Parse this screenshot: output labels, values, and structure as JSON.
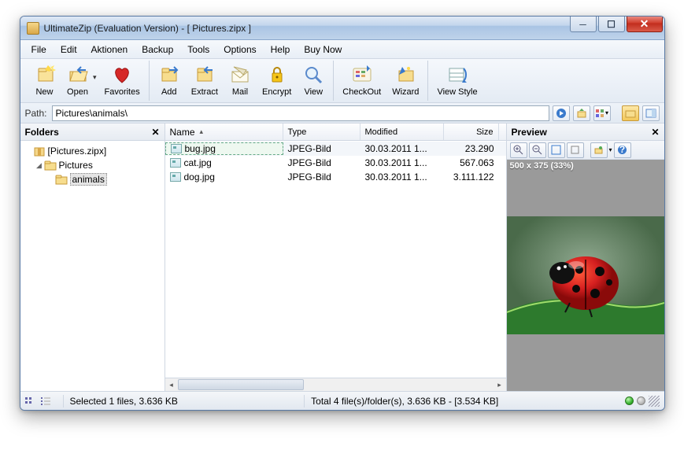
{
  "window": {
    "title": "UltimateZip (Evaluation Version) - [ Pictures.zipx ]"
  },
  "menu": {
    "file": "File",
    "edit": "Edit",
    "aktionen": "Aktionen",
    "backup": "Backup",
    "tools": "Tools",
    "options": "Options",
    "help": "Help",
    "buy_now": "Buy Now"
  },
  "toolbar": {
    "new": "New",
    "open": "Open",
    "favorites": "Favorites",
    "add": "Add",
    "extract": "Extract",
    "mail": "Mail",
    "encrypt": "Encrypt",
    "view": "View",
    "checkout": "CheckOut",
    "wizard": "Wizard",
    "view_style": "View Style"
  },
  "pathbar": {
    "label": "Path:",
    "value": "Pictures\\animals\\"
  },
  "folders": {
    "header": "Folders",
    "root": "[Pictures.zipx]",
    "pictures": "Pictures",
    "animals": "animals"
  },
  "columns": {
    "name": "Name",
    "type": "Type",
    "modified": "Modified",
    "size": "Size"
  },
  "files": [
    {
      "name": "bug.jpg",
      "type": "JPEG-Bild",
      "modified": "30.03.2011  1...",
      "size": "23.290",
      "selected": true
    },
    {
      "name": "cat.jpg",
      "type": "JPEG-Bild",
      "modified": "30.03.2011  1...",
      "size": "567.063",
      "selected": false
    },
    {
      "name": "dog.jpg",
      "type": "JPEG-Bild",
      "modified": "30.03.2011  1...",
      "size": "3.111.122",
      "selected": false
    }
  ],
  "preview": {
    "header": "Preview",
    "info": "500 x 375 (33%)"
  },
  "status": {
    "selection": "Selected 1 files, 3.636 KB",
    "total": "Total 4 file(s)/folder(s), 3.636 KB - [3.534 KB]"
  }
}
